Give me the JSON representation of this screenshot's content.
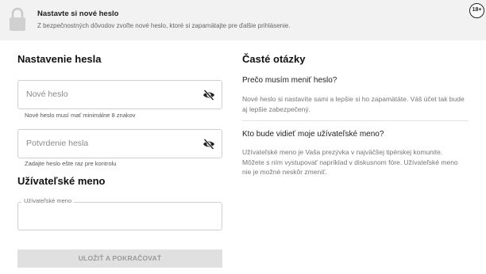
{
  "banner": {
    "title": "Nastavte si nové heslo",
    "text": "Z bezpečnostných dôvodov zvoľte nové heslo, ktoré si zapamätajte pre ďalšie prihlásenie.",
    "age_badge": "18+",
    "icon": "lock-icon"
  },
  "form": {
    "heading": "Nastavenie hesla",
    "new_password": {
      "placeholder": "Nové heslo",
      "hint": "Nové heslo musí mať minimálne 8 znakov",
      "toggle_icon": "eye-off-icon"
    },
    "confirm_password": {
      "placeholder": "Potvrdenie hesla",
      "hint": "Zadajte heslo ešte raz pre kontrolu",
      "toggle_icon": "eye-off-icon"
    },
    "username_heading": "Užívateľské meno",
    "username": {
      "label": "Užívateľské meno",
      "value": ""
    },
    "submit_label": "ULOŽIŤ A POKRAČOVAŤ"
  },
  "faq": {
    "heading": "Časté otázky",
    "items": [
      {
        "question": "Prečo musím meniť heslo?",
        "answer": "Nové heslo si nastavíte sami a lepšie si ho zapamätáte. Váš účet tak bude aj lepšie zabezpečený."
      },
      {
        "question": "Kto bude vidieť moje užívateľské meno?",
        "answer": "Užívateľské meno je Vaša prezývka v najväčšej tipérskej komunite. Môžete s ním vystupovať napríklad v diskusnom fóre. Užívateľské meno nie je možné neskôr zmeniť."
      }
    ]
  }
}
